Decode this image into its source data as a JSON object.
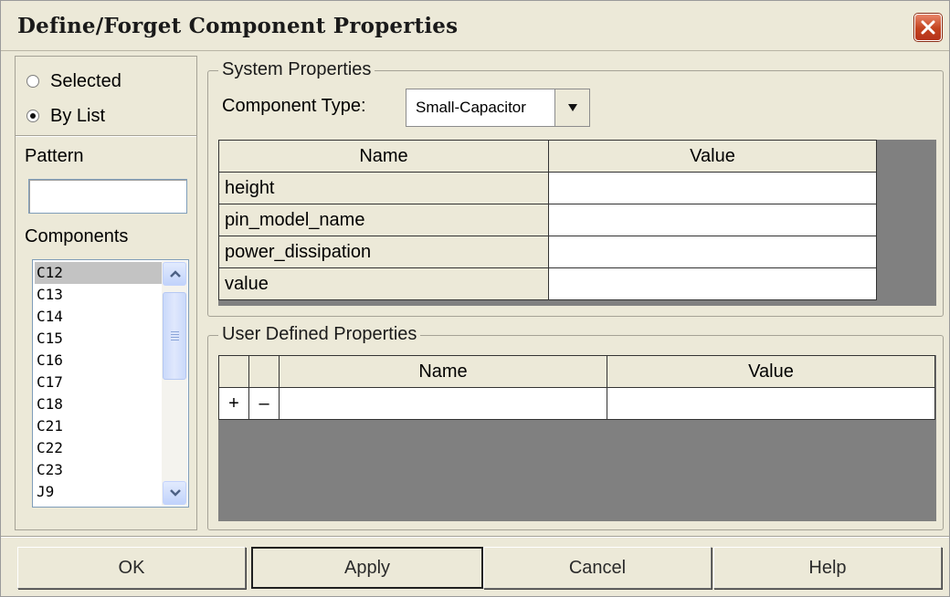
{
  "window": {
    "title": "Define/Forget Component Properties"
  },
  "selection_mode": {
    "options": [
      {
        "label": "Selected",
        "checked": false
      },
      {
        "label": "By List",
        "checked": true
      }
    ]
  },
  "pattern": {
    "label": "Pattern",
    "value": ""
  },
  "components": {
    "label": "Components",
    "items": [
      "C12",
      "C13",
      "C14",
      "C15",
      "C16",
      "C17",
      "C18",
      "C21",
      "C22",
      "C23",
      "J9"
    ],
    "selected": "C12"
  },
  "system_properties": {
    "title": "System Properties",
    "component_type_label": "Component Type:",
    "component_type_value": "Small-Capacitor",
    "columns": [
      "Name",
      "Value"
    ],
    "rows": [
      {
        "name": "height",
        "value": ""
      },
      {
        "name": "pin_model_name",
        "value": ""
      },
      {
        "name": "power_dissipation",
        "value": ""
      },
      {
        "name": "value",
        "value": ""
      }
    ]
  },
  "user_defined_properties": {
    "title": "User Defined Properties",
    "columns": [
      "",
      "",
      "Name",
      "Value"
    ],
    "add_label": "+",
    "remove_label": "–",
    "rows": [
      {
        "name": "",
        "value": ""
      }
    ]
  },
  "buttons": {
    "ok": "OK",
    "apply": "Apply",
    "cancel": "Cancel",
    "help": "Help"
  },
  "colors": {
    "close_button": "#c4431f",
    "grid_background": "#808080",
    "dialog_background": "#ece9d8"
  }
}
